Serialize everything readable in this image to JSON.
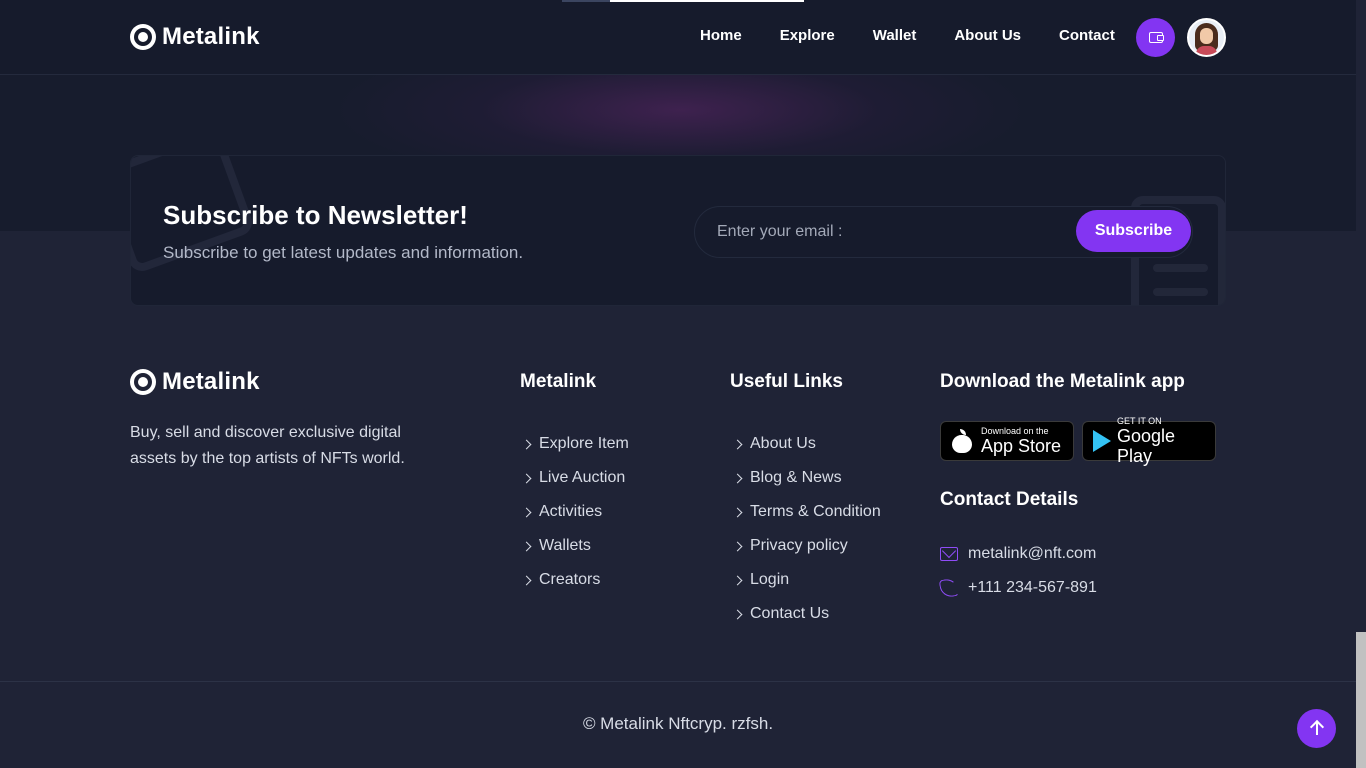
{
  "brand": {
    "name": "Metalink",
    "accent_color": "#8335f2",
    "icon": "metalink-logo-icon"
  },
  "header": {
    "nav": [
      "Home",
      "Explore",
      "Wallet",
      "About Us",
      "Contact"
    ],
    "wallet_icon": "wallet-icon",
    "avatar_icon": "user-avatar"
  },
  "newsletter": {
    "title": "Subscribe to Newsletter!",
    "subtitle": "Subscribe to get latest updates and information.",
    "placeholder": "Enter your email :",
    "button": "Subscribe"
  },
  "footer": {
    "description": "Buy, sell and discover exclusive digital assets by the top artists of NFTs world.",
    "columns": [
      {
        "title": "Metalink",
        "links": [
          "Explore Item",
          "Live Auction",
          "Activities",
          "Wallets",
          "Creators"
        ]
      },
      {
        "title": "Useful Links",
        "links": [
          "About Us",
          "Blog & News",
          "Terms & Condition",
          "Privacy policy",
          "Login",
          "Contact Us"
        ]
      }
    ],
    "download": {
      "title": "Download the Metalink app",
      "app_store": {
        "small": "Download on the",
        "big": "App Store"
      },
      "google_play": {
        "small": "GET IT ON",
        "big": "Google Play"
      }
    },
    "contact": {
      "title": "Contact Details",
      "email": "metalink@nft.com",
      "phone": "+111 234-567-891"
    },
    "copyright": "© Metalink Nftcryp. rzfsh."
  }
}
